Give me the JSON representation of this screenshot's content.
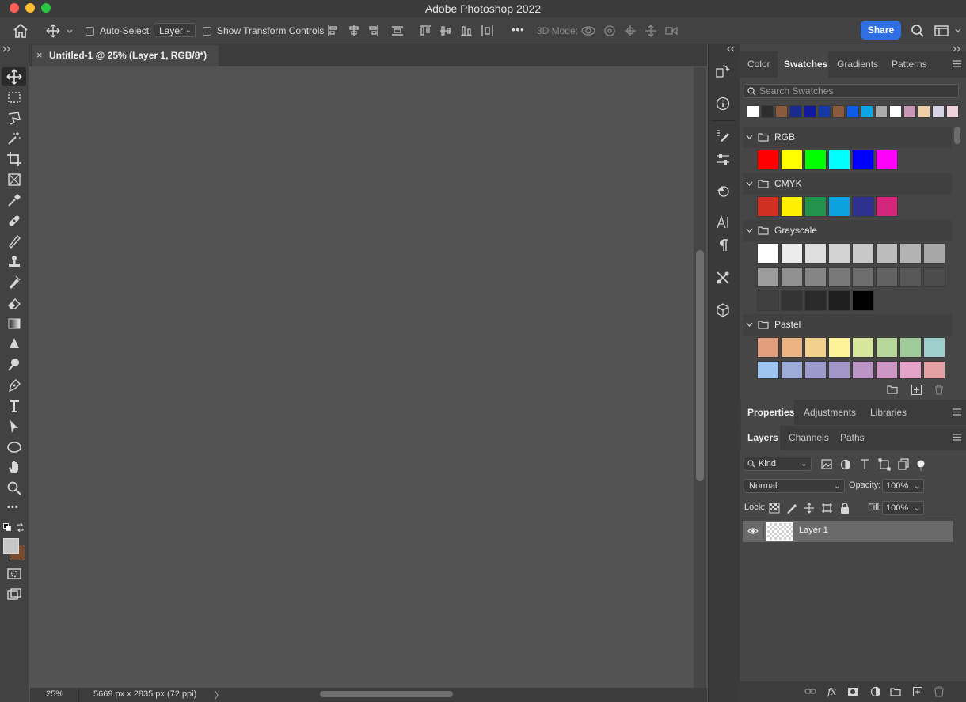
{
  "window": {
    "title": "Adobe Photoshop 2022"
  },
  "options_bar": {
    "auto_select_label": "Auto-Select:",
    "auto_select_value": "Layer",
    "show_transform_label": "Show Transform Controls",
    "more_label": "•••",
    "mode_3d_label": "3D Mode:",
    "share_label": "Share"
  },
  "document": {
    "tab_title": "Untitled-1 @ 25% (Layer 1, RGB/8*)",
    "close_glyph": "×",
    "zoom": "25%",
    "doc_info": "5669 px x 2835 px (72 ppi)",
    "status_arrow": "〉"
  },
  "toolbar": {
    "more_tools": "•••",
    "foreground_color": "#c6c6c6",
    "background_color": "#7a4a2c"
  },
  "top_panel": {
    "tabs": [
      "Color",
      "Swatches",
      "Gradients",
      "Patterns"
    ],
    "active_tab": "Swatches",
    "search_placeholder": "Search Swatches",
    "recent_swatches": [
      "#ffffff",
      "#2d2d2d",
      "#8b5a3c",
      "#1a2b8c",
      "#111a9e",
      "#133aa6",
      "#8b5a3c",
      "#0f5de6",
      "#0fa4e6",
      "#ababab",
      "#ffffff",
      "#c796b4",
      "#f0cfa8",
      "#d6d2e4",
      "#f0d2df"
    ],
    "groups": [
      {
        "name": "RGB",
        "swatches": [
          "#ff0000",
          "#ffff00",
          "#00ff00",
          "#00ffff",
          "#0000ff",
          "#ff00ff"
        ]
      },
      {
        "name": "CMYK",
        "swatches": [
          "#d12f22",
          "#ffef00",
          "#22934a",
          "#0ea1e0",
          "#2e3190",
          "#d3267b"
        ]
      },
      {
        "name": "Grayscale",
        "swatches": [
          "#ffffff",
          "#ececec",
          "#dedede",
          "#d3d3d3",
          "#c8c8c8",
          "#bcbcbc",
          "#b3b3b3",
          "#a7a7a7",
          "#9c9c9c",
          "#909090",
          "#858585",
          "#797979",
          "#6e6e6e",
          "#626262",
          "#575757",
          "#4b4b4b",
          "#404040",
          "#343434",
          "#2a2a2a",
          "#1e1e1e",
          "#000000"
        ]
      },
      {
        "name": "Pastel",
        "swatches": [
          "#e29d7c",
          "#ecb482",
          "#f2d08e",
          "#fff399",
          "#d7e59d",
          "#b7d89a",
          "#a0cc9b",
          "#9dd0cc",
          "#9ec5ef",
          "#9dadd8",
          "#9c99cc",
          "#a295c8",
          "#b994c5",
          "#cc97c4",
          "#e3a2c7",
          "#e3a1a5"
        ]
      }
    ]
  },
  "props_panel": {
    "tabs": [
      "Properties",
      "Adjustments",
      "Libraries"
    ],
    "active_tab": "Properties"
  },
  "layers_panel": {
    "tabs": [
      "Layers",
      "Channels",
      "Paths"
    ],
    "active_tab": "Layers",
    "filter_kind": "Kind",
    "blend_mode": "Normal",
    "opacity_label": "Opacity:",
    "opacity_value": "100%",
    "lock_label": "Lock:",
    "fill_label": "Fill:",
    "fill_value": "100%",
    "layers": [
      {
        "name": "Layer 1",
        "visible": true,
        "selected": true
      }
    ]
  }
}
